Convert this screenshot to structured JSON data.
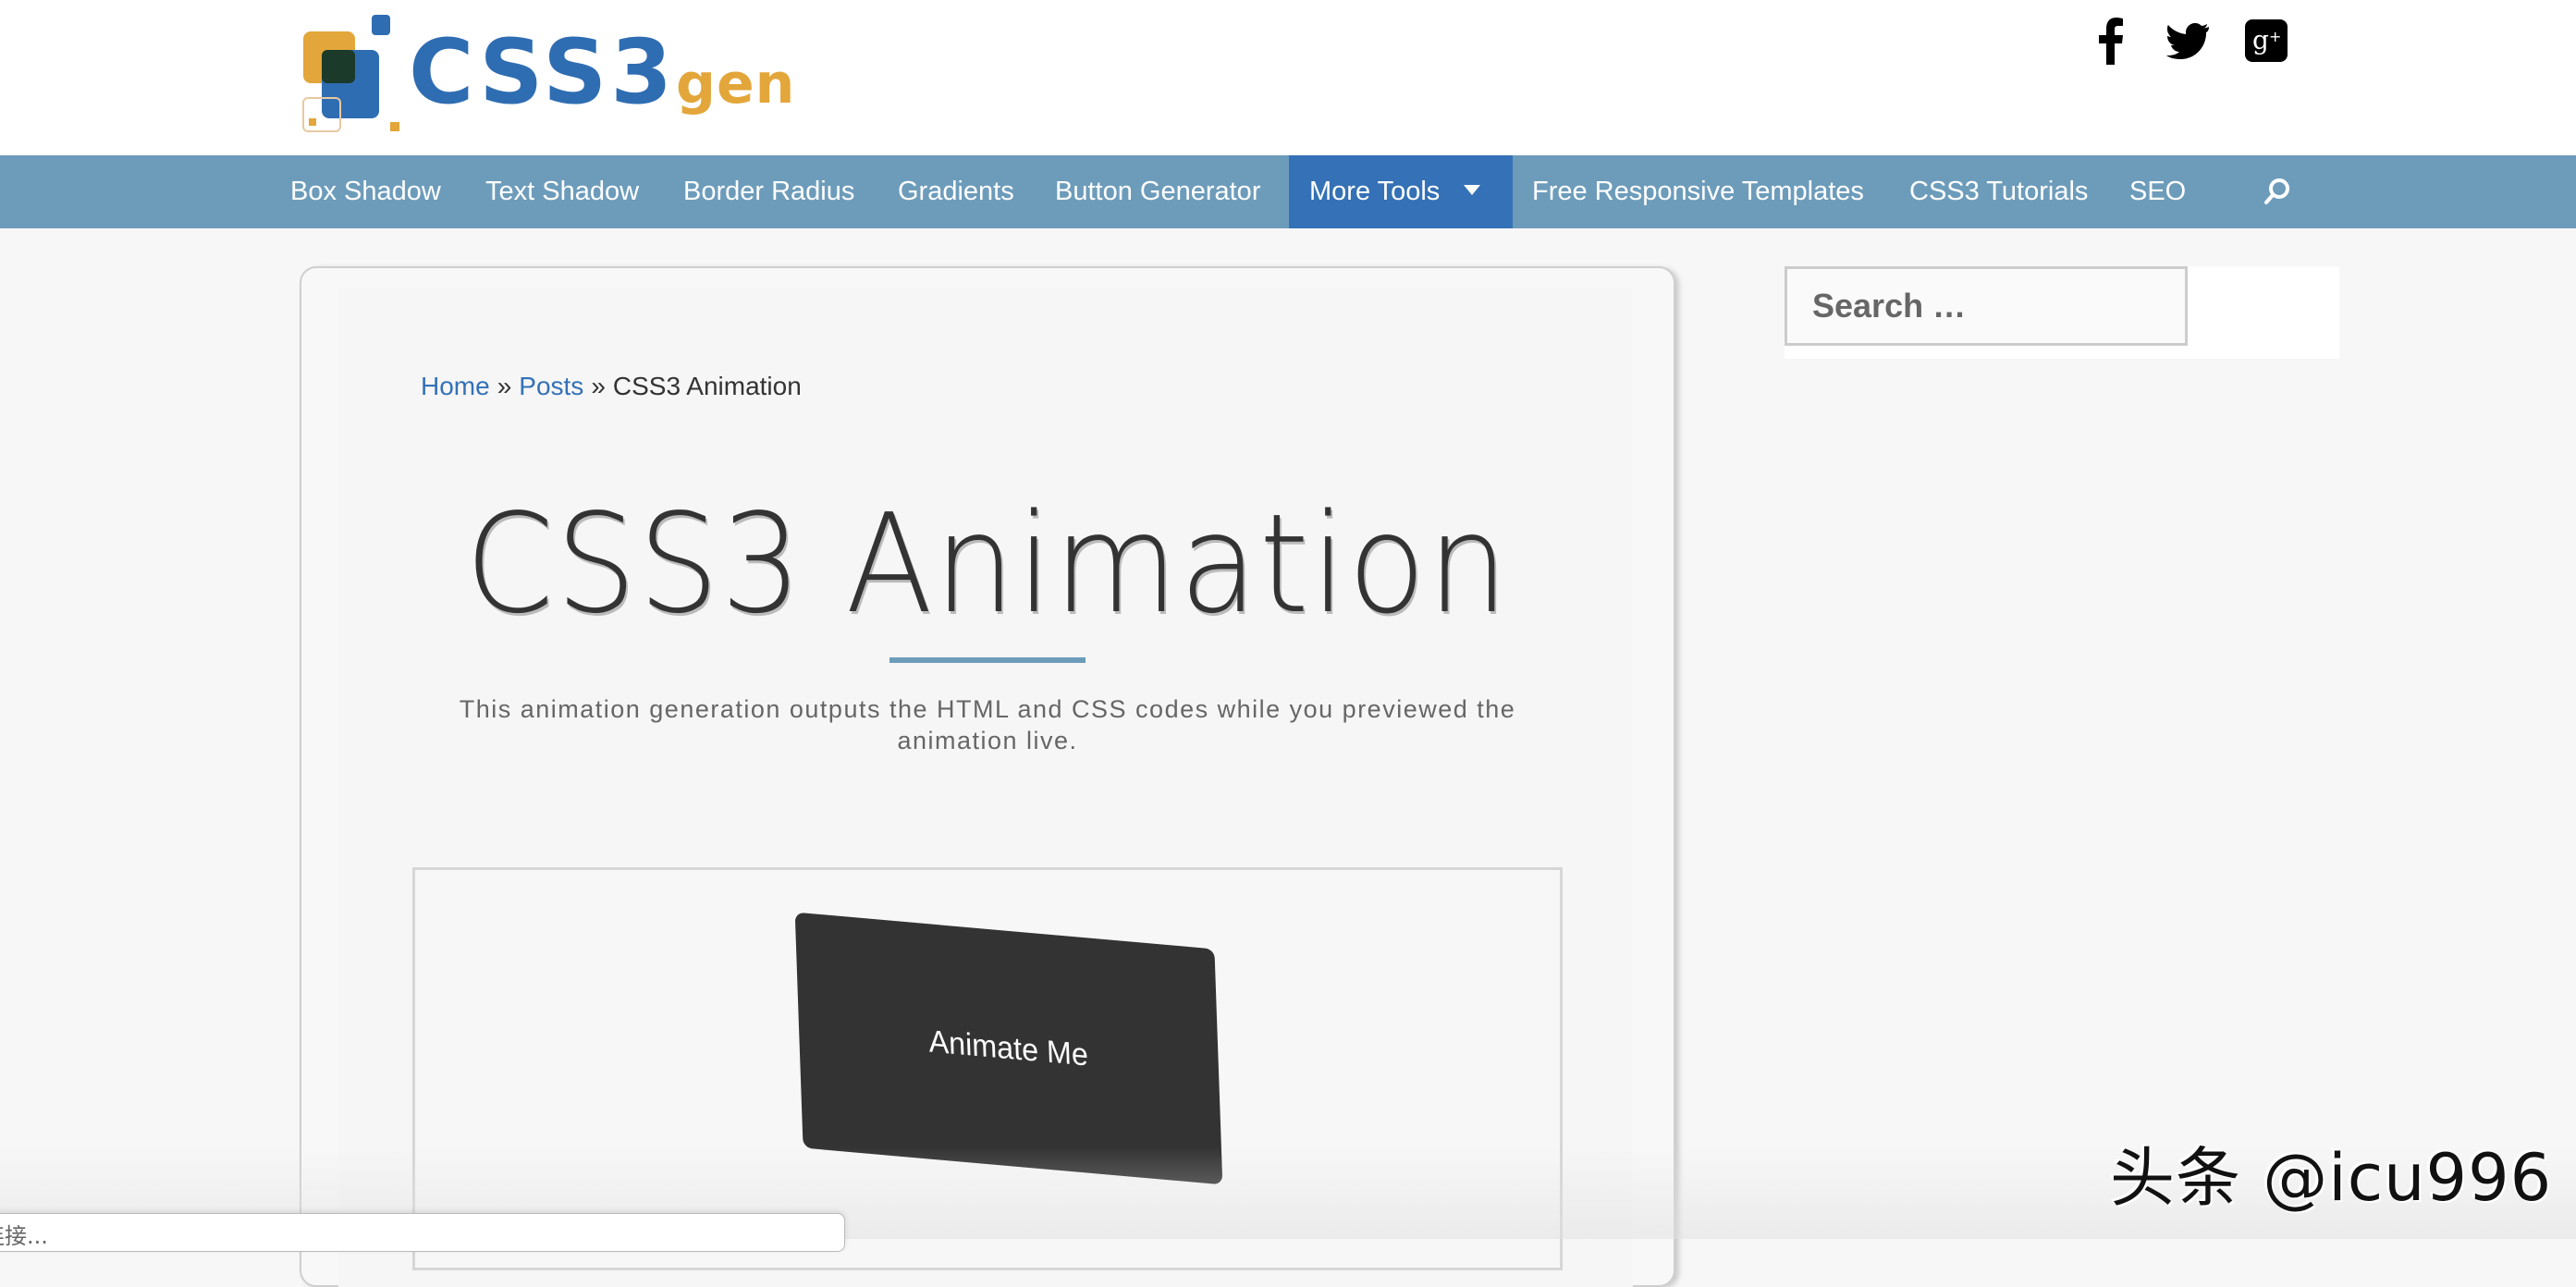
{
  "header": {
    "logo": {
      "main": "CSS3",
      "suffix": "gen",
      "colors": {
        "blue": "#2f6db2",
        "orange": "#e3a63a"
      }
    },
    "social": [
      {
        "name": "facebook-icon",
        "label": "Facebook"
      },
      {
        "name": "twitter-icon",
        "label": "Twitter"
      },
      {
        "name": "google-plus-icon",
        "label": "Google+"
      }
    ]
  },
  "nav": {
    "bg_color": "#6d9cbb",
    "active_color": "#3471b6",
    "items": [
      {
        "label": "Box Shadow"
      },
      {
        "label": "Text Shadow"
      },
      {
        "label": "Border Radius"
      },
      {
        "label": "Gradients"
      },
      {
        "label": "Button Generator"
      },
      {
        "label": "More Tools",
        "active": true,
        "dropdown": true
      },
      {
        "label": "Free Responsive Templates"
      },
      {
        "label": "CSS3 Tutorials"
      },
      {
        "label": "SEO"
      }
    ],
    "search_icon": "search-icon"
  },
  "breadcrumb": {
    "items": [
      {
        "label": "Home",
        "link": true
      },
      {
        "label": "Posts",
        "link": true
      },
      {
        "label": "CSS3 Animation",
        "link": false
      }
    ],
    "separator": "»"
  },
  "main": {
    "title": "CSS3 Animation",
    "subtitle": "This animation generation outputs the HTML and CSS codes while you previewed the animation live.",
    "demo_button_label": "Animate Me"
  },
  "sidebar": {
    "search_placeholder": "Search …"
  },
  "status_bar": {
    "text": "连接..."
  },
  "watermark": "头条 @icu996"
}
